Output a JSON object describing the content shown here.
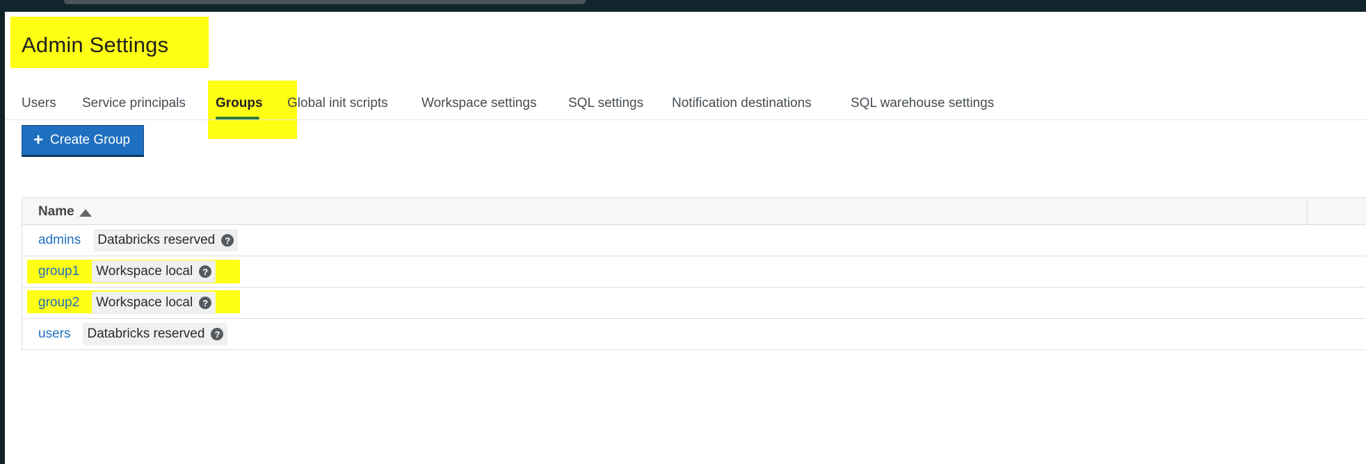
{
  "header": {
    "title": "Admin Settings"
  },
  "tabs": [
    {
      "label": "Users"
    },
    {
      "label": "Service principals"
    },
    {
      "label": "Groups",
      "active": true
    },
    {
      "label": "Global init scripts"
    },
    {
      "label": "Workspace settings"
    },
    {
      "label": "SQL settings"
    },
    {
      "label": "Notification destinations"
    },
    {
      "label": "SQL warehouse settings"
    }
  ],
  "toolbar": {
    "create_label": "Create Group",
    "create_icon": "plus-icon"
  },
  "table": {
    "columns": [
      "Name"
    ],
    "sort": "ascending",
    "rows": [
      {
        "name": "admins",
        "badge": "Databricks reserved",
        "help_icon": "question-circle-icon"
      },
      {
        "name": "group1",
        "badge": "Workspace local",
        "help_icon": "question-circle-icon"
      },
      {
        "name": "group2",
        "badge": "Workspace local",
        "help_icon": "question-circle-icon"
      },
      {
        "name": "users",
        "badge": "Databricks reserved",
        "help_icon": "question-circle-icon"
      }
    ]
  },
  "colors": {
    "accent": "#1f6fc0",
    "active_tab_underline": "#2e7d32",
    "highlight": "#ffff00",
    "topbar": "#13262d"
  }
}
